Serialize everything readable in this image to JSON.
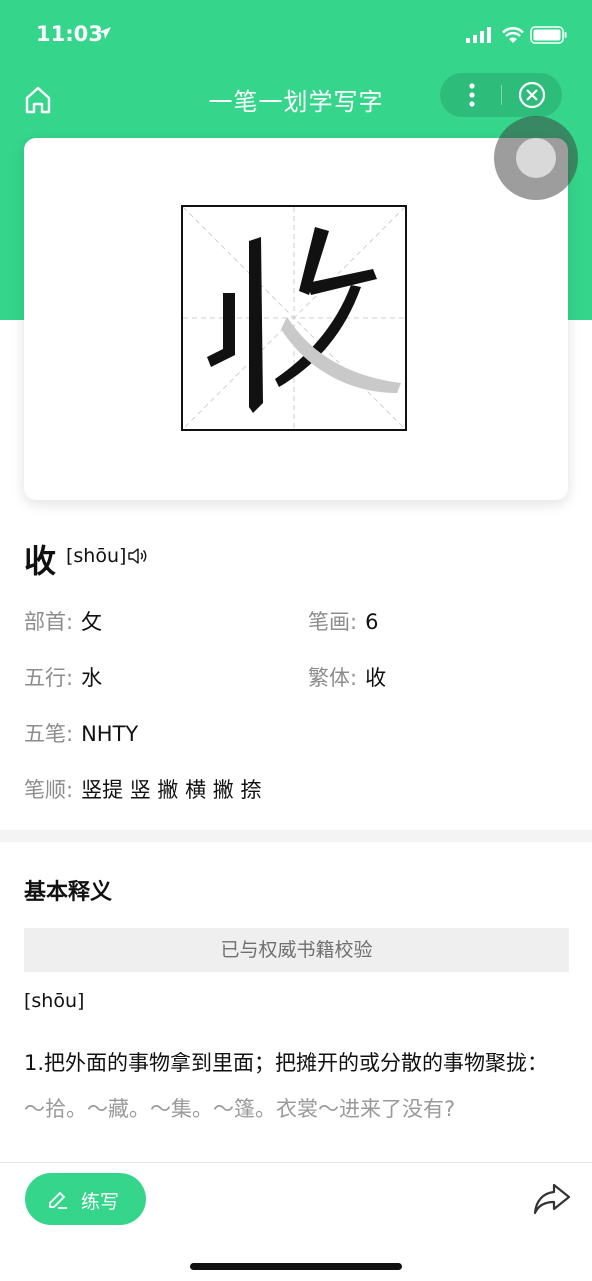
{
  "status_bar": {
    "time": "11:03"
  },
  "nav": {
    "title": "一笔一划学写字",
    "icons": [
      "home-icon",
      "more-icon",
      "close-icon"
    ]
  },
  "character": {
    "char": "收",
    "pinyin": "[shōu]",
    "fields": [
      {
        "label": "部首:",
        "value": "攵"
      },
      {
        "label": "笔画:",
        "value": "6"
      },
      {
        "label": "五行:",
        "value": "水"
      },
      {
        "label": "繁体:",
        "value": "收"
      },
      {
        "label": "五笔:",
        "value": "NHTY"
      },
      {
        "label": "笔顺:",
        "value": "竖提 竖 撇 横 撇 捺"
      }
    ]
  },
  "basic": {
    "title": "基本释义",
    "verified": "已与权威书籍校验",
    "pinyin": "[shōu]",
    "definition": "1.把外面的事物拿到里面；把摊开的或分散的事物聚拢：",
    "examples": "～拾。～藏。～集。～篷。衣裳～进来了没有?"
  },
  "bottom": {
    "practice_label": "练写",
    "share_icon": "share-icon"
  },
  "colors": {
    "brand": "#35d68b",
    "label_gray": "#8c8c8c"
  }
}
